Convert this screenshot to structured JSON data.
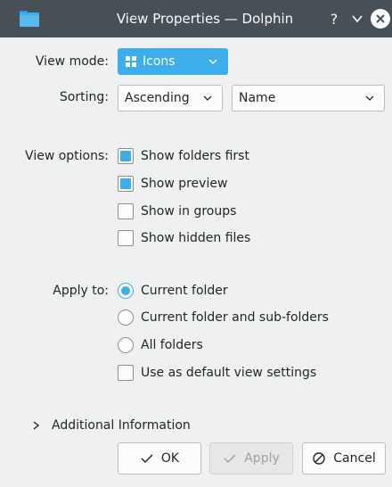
{
  "window": {
    "title": "View Properties — Dolphin",
    "help_glyph": "?",
    "app_icon": "folder-icon",
    "colors": {
      "titlebar": "#475057",
      "accent": "#3daee9"
    }
  },
  "view_mode": {
    "label": "View mode:",
    "value": "Icons",
    "icon": "icons-view-icon"
  },
  "sorting": {
    "label": "Sorting:",
    "order": "Ascending",
    "field": "Name"
  },
  "view_options": {
    "label": "View options:",
    "items": [
      {
        "label": "Show folders first",
        "checked": true
      },
      {
        "label": "Show preview",
        "checked": true
      },
      {
        "label": "Show in groups",
        "checked": false
      },
      {
        "label": "Show hidden files",
        "checked": false
      }
    ]
  },
  "apply_to": {
    "label": "Apply to:",
    "options": [
      {
        "label": "Current folder",
        "selected": true
      },
      {
        "label": "Current folder and sub-folders",
        "selected": false
      },
      {
        "label": "All folders",
        "selected": false
      }
    ],
    "default_checkbox": {
      "label": "Use as default view settings",
      "checked": false
    }
  },
  "additional_info": {
    "label": "Additional Information"
  },
  "buttons": {
    "ok": "OK",
    "apply": "Apply",
    "cancel": "Cancel"
  }
}
